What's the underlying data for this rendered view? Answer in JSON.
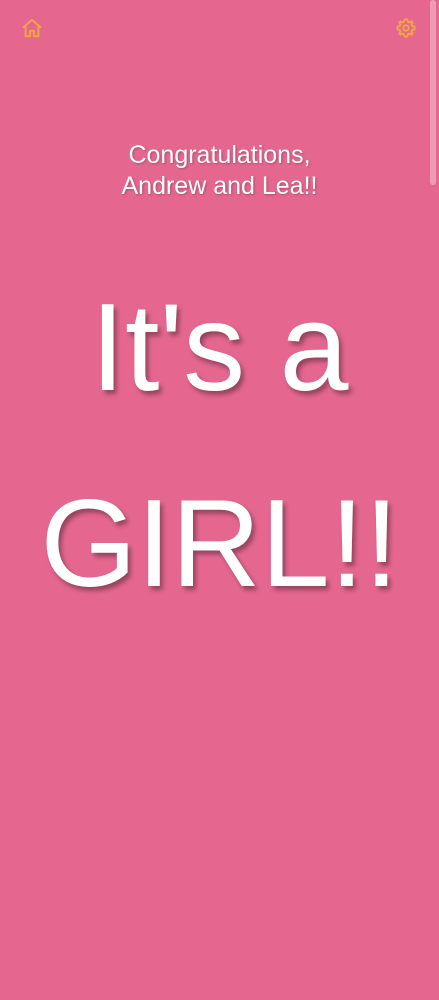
{
  "header": {
    "home_icon": "home-icon",
    "settings_icon": "gear-icon",
    "icon_color": "#f2a93b"
  },
  "message": {
    "line1": "Congratulations,",
    "line2": "Andrew and Lea!!"
  },
  "announcement": {
    "line1": "It's a",
    "line2": "GIRL!!"
  },
  "theme": {
    "background": "#e56790",
    "text": "#ffffff"
  }
}
